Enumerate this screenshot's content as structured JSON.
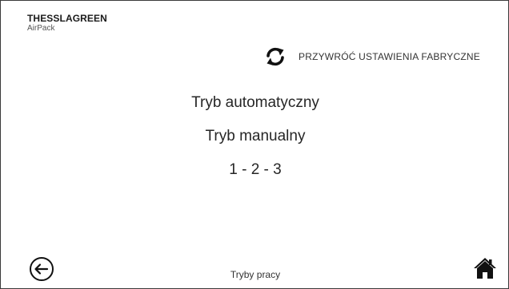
{
  "header": {
    "brand": "THESSLAGREEN",
    "product": "AirPack"
  },
  "toolbar": {
    "reset_label": "PRZYWRÓĆ USTAWIENIA FABRYCZNE",
    "reset_icon": "refresh-icon"
  },
  "menu": {
    "items": [
      {
        "label": "Tryb automatyczny"
      },
      {
        "label": "Tryb manualny"
      },
      {
        "label": "1 - 2 - 3"
      }
    ]
  },
  "footer": {
    "title": "Tryby pracy",
    "back_icon": "back-arrow-icon",
    "home_icon": "home-icon"
  },
  "colors": {
    "border": "#3a3a3a",
    "text": "#262626",
    "icon": "#111111"
  }
}
